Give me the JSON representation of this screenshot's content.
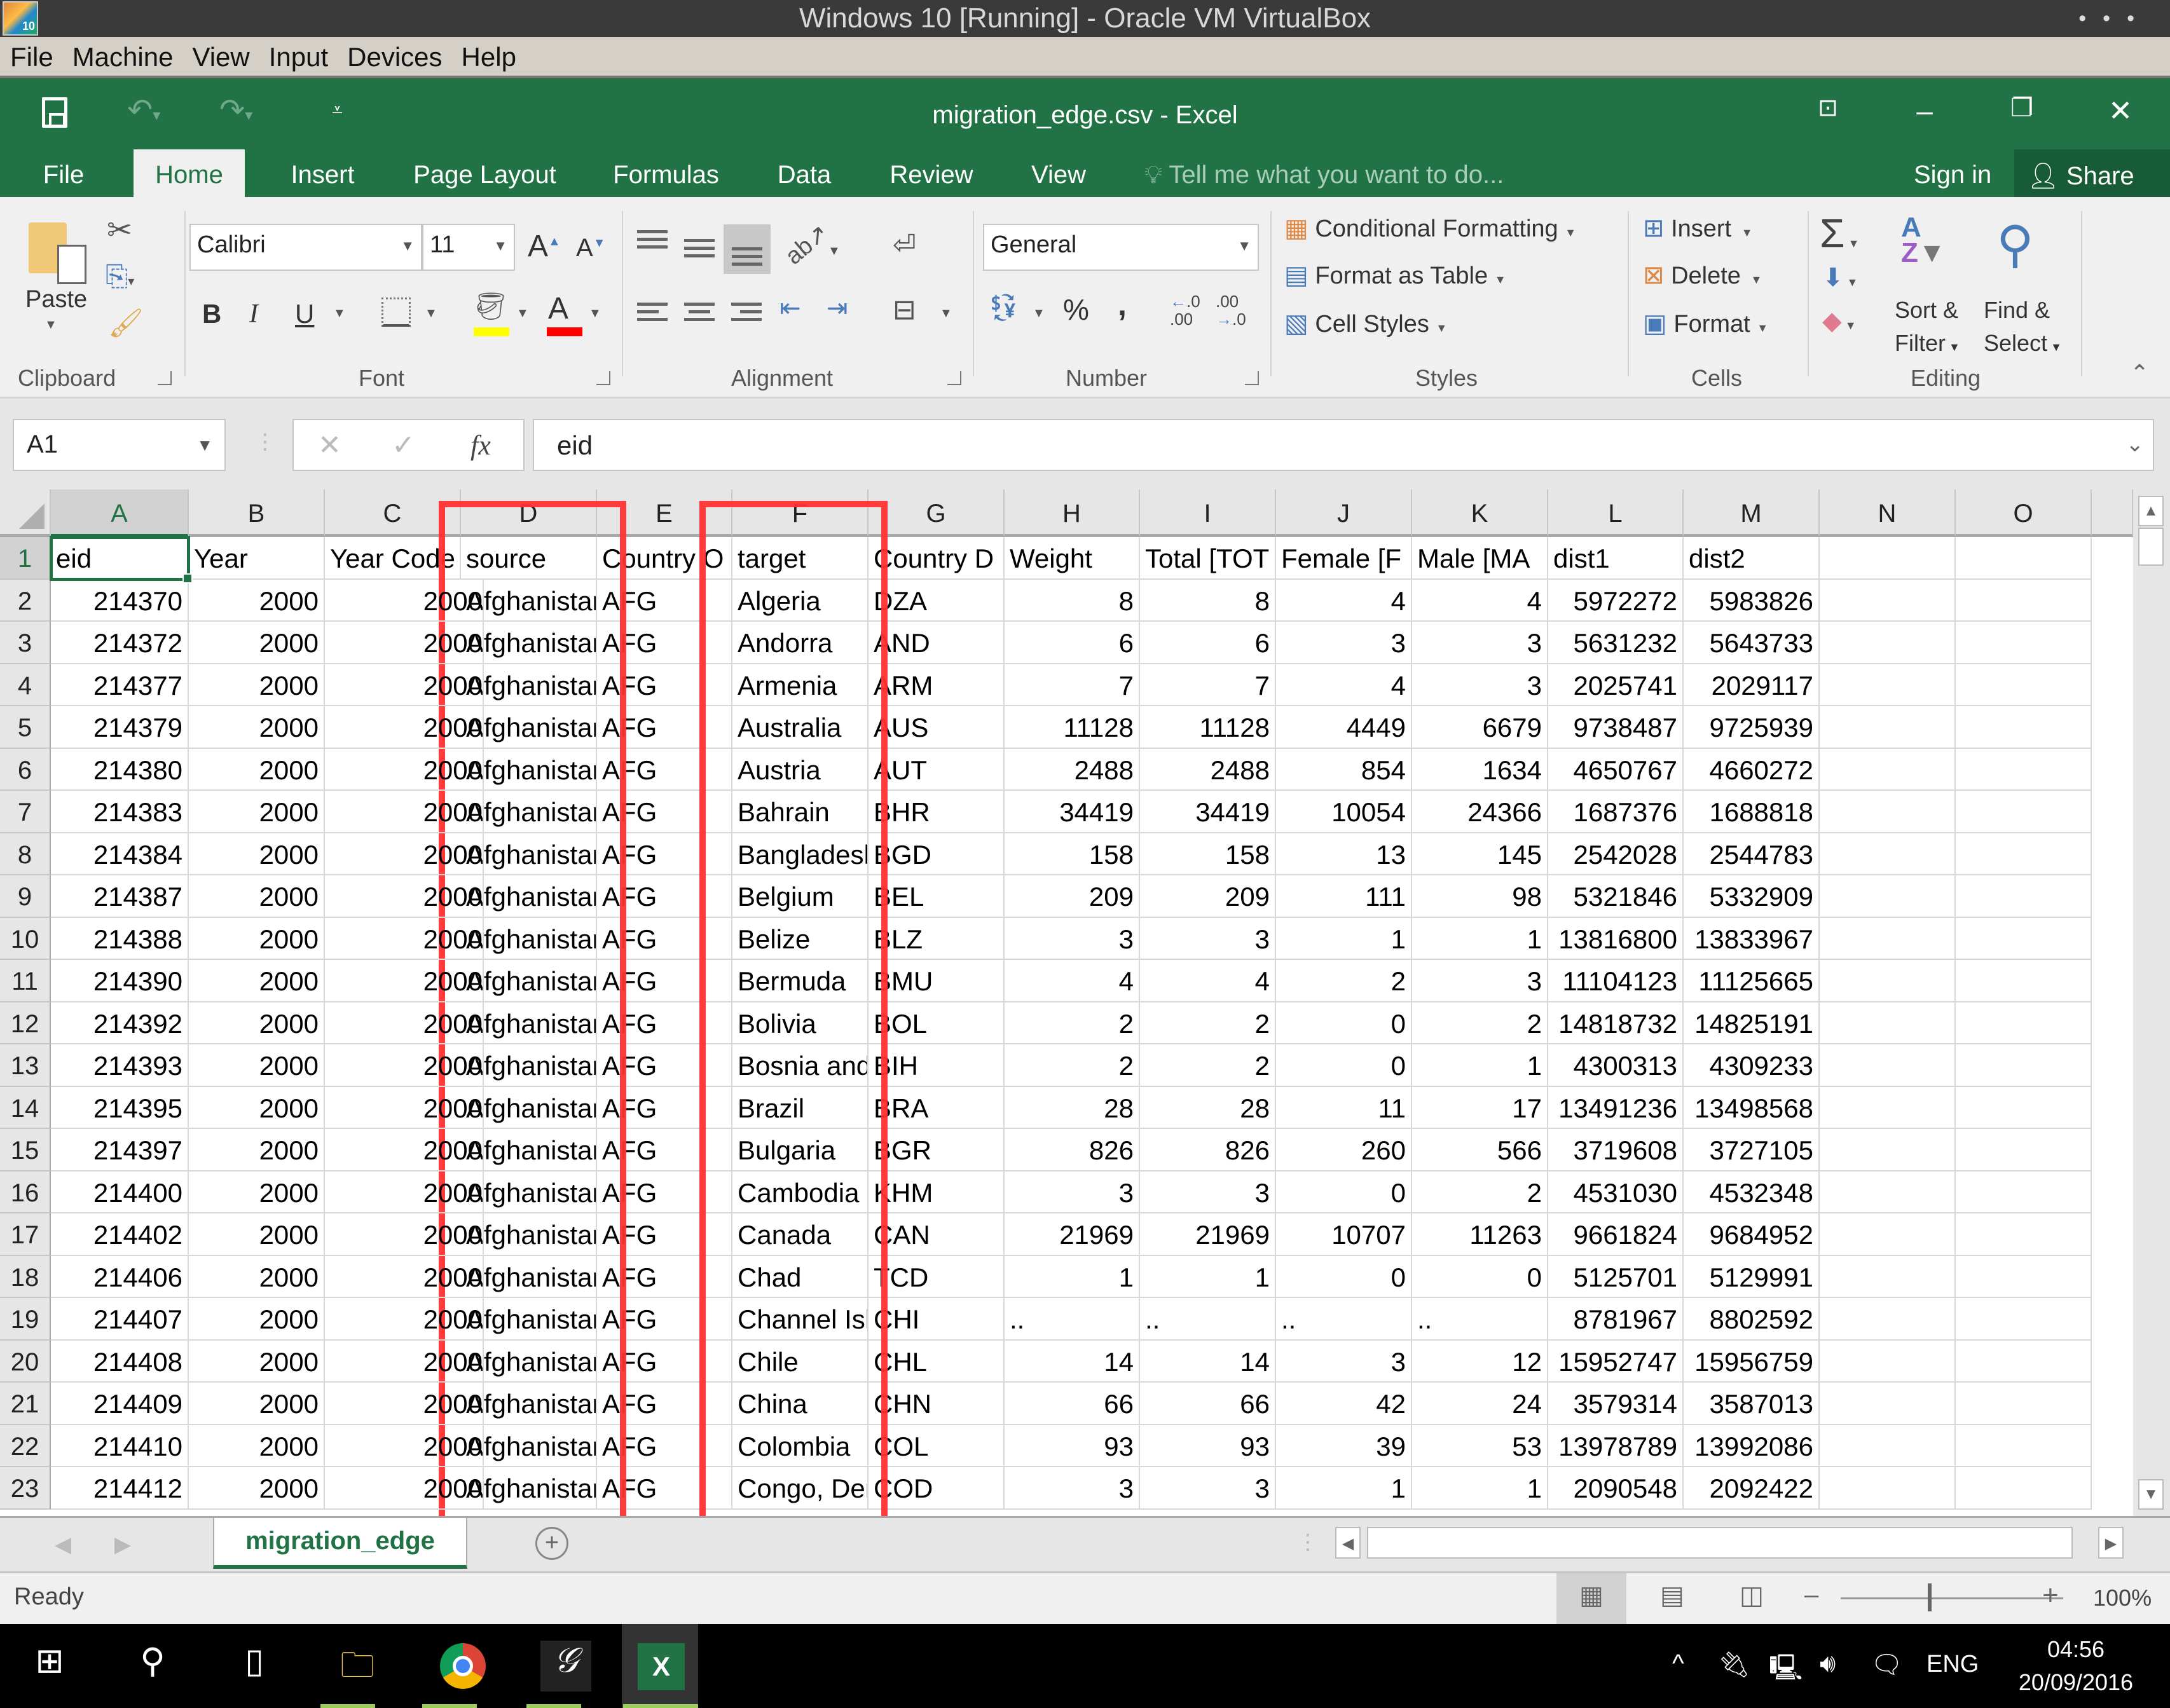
{
  "vbox": {
    "title": "Windows 10 [Running] - Oracle VM VirtualBox",
    "menu": [
      "File",
      "Machine",
      "View",
      "Input",
      "Devices",
      "Help"
    ]
  },
  "excel": {
    "doc_title": "migration_edge.csv - Excel",
    "tabs": [
      "File",
      "Home",
      "Insert",
      "Page Layout",
      "Formulas",
      "Data",
      "Review",
      "View"
    ],
    "active_tab": "Home",
    "tell_me": "Tell me what you want to do...",
    "sign_in": "Sign in",
    "share": "Share"
  },
  "ribbon": {
    "clipboard": {
      "label": "Clipboard",
      "paste": "Paste"
    },
    "font": {
      "label": "Font",
      "font_name": "Calibri",
      "font_size": "11",
      "bold": "B",
      "italic": "I",
      "underline": "U",
      "highlight_color": "#ffff00",
      "font_color": "#ff0000"
    },
    "alignment": {
      "label": "Alignment"
    },
    "number": {
      "label": "Number",
      "format": "General",
      "percent": "%",
      "comma": ","
    },
    "styles": {
      "label": "Styles",
      "conditional": "Conditional Formatting",
      "format_table": "Format as Table",
      "cell_styles": "Cell Styles"
    },
    "cells": {
      "label": "Cells",
      "insert": "Insert",
      "delete": "Delete",
      "format": "Format"
    },
    "editing": {
      "label": "Editing",
      "sort": "Sort &",
      "filter": "Filter",
      "find": "Find &",
      "select": "Select"
    }
  },
  "formula_bar": {
    "name_box": "A1",
    "content": "eid"
  },
  "sheet": {
    "columns": [
      "A",
      "B",
      "C",
      "D",
      "E",
      "F",
      "G",
      "H",
      "I",
      "J",
      "K",
      "L",
      "M",
      "N",
      "O"
    ],
    "headers": [
      "eid",
      "Year",
      "Year Code",
      "source",
      "Country Origin Code",
      "target",
      "Country Dest Code",
      "Weight",
      "Total [TOTAL]",
      "Female [FEMALE]",
      "Male [MALE]",
      "dist1",
      "dist2"
    ],
    "header_display": [
      "eid",
      "Year",
      "Year Code",
      "source",
      "Country O",
      "target",
      "Country D",
      "Weight",
      "Total [TOT",
      "Female [F",
      "Male [MA",
      "dist1",
      "dist2"
    ],
    "rows": [
      [
        "214370",
        "2000",
        "2000",
        "Afghanistan",
        "AFG",
        "Algeria",
        "DZA",
        "8",
        "8",
        "4",
        "4",
        "5972272",
        "5983826"
      ],
      [
        "214372",
        "2000",
        "2000",
        "Afghanistan",
        "AFG",
        "Andorra",
        "AND",
        "6",
        "6",
        "3",
        "3",
        "5631232",
        "5643733"
      ],
      [
        "214377",
        "2000",
        "2000",
        "Afghanistan",
        "AFG",
        "Armenia",
        "ARM",
        "7",
        "7",
        "4",
        "3",
        "2025741",
        "2029117"
      ],
      [
        "214379",
        "2000",
        "2000",
        "Afghanistan",
        "AFG",
        "Australia",
        "AUS",
        "11128",
        "11128",
        "4449",
        "6679",
        "9738487",
        "9725939"
      ],
      [
        "214380",
        "2000",
        "2000",
        "Afghanistan",
        "AFG",
        "Austria",
        "AUT",
        "2488",
        "2488",
        "854",
        "1634",
        "4650767",
        "4660272"
      ],
      [
        "214383",
        "2000",
        "2000",
        "Afghanistan",
        "AFG",
        "Bahrain",
        "BHR",
        "34419",
        "34419",
        "10054",
        "24366",
        "1687376",
        "1688818"
      ],
      [
        "214384",
        "2000",
        "2000",
        "Afghanistan",
        "AFG",
        "Bangladesh",
        "BGD",
        "158",
        "158",
        "13",
        "145",
        "2542028",
        "2544783"
      ],
      [
        "214387",
        "2000",
        "2000",
        "Afghanistan",
        "AFG",
        "Belgium",
        "BEL",
        "209",
        "209",
        "111",
        "98",
        "5321846",
        "5332909"
      ],
      [
        "214388",
        "2000",
        "2000",
        "Afghanistan",
        "AFG",
        "Belize",
        "BLZ",
        "3",
        "3",
        "1",
        "1",
        "13816800",
        "13833967"
      ],
      [
        "214390",
        "2000",
        "2000",
        "Afghanistan",
        "AFG",
        "Bermuda",
        "BMU",
        "4",
        "4",
        "2",
        "3",
        "11104123",
        "11125665"
      ],
      [
        "214392",
        "2000",
        "2000",
        "Afghanistan",
        "AFG",
        "Bolivia",
        "BOL",
        "2",
        "2",
        "0",
        "2",
        "14818732",
        "14825191"
      ],
      [
        "214393",
        "2000",
        "2000",
        "Afghanistan",
        "AFG",
        "Bosnia and",
        "BIH",
        "2",
        "2",
        "0",
        "1",
        "4300313",
        "4309233"
      ],
      [
        "214395",
        "2000",
        "2000",
        "Afghanistan",
        "AFG",
        "Brazil",
        "BRA",
        "28",
        "28",
        "11",
        "17",
        "13491236",
        "13498568"
      ],
      [
        "214397",
        "2000",
        "2000",
        "Afghanistan",
        "AFG",
        "Bulgaria",
        "BGR",
        "826",
        "826",
        "260",
        "566",
        "3719608",
        "3727105"
      ],
      [
        "214400",
        "2000",
        "2000",
        "Afghanistan",
        "AFG",
        "Cambodia",
        "KHM",
        "3",
        "3",
        "0",
        "2",
        "4531030",
        "4532348"
      ],
      [
        "214402",
        "2000",
        "2000",
        "Afghanistan",
        "AFG",
        "Canada",
        "CAN",
        "21969",
        "21969",
        "10707",
        "11263",
        "9661824",
        "9684952"
      ],
      [
        "214406",
        "2000",
        "2000",
        "Afghanistan",
        "AFG",
        "Chad",
        "TCD",
        "1",
        "1",
        "0",
        "0",
        "5125701",
        "5129991"
      ],
      [
        "214407",
        "2000",
        "2000",
        "Afghanistan",
        "AFG",
        "Channel Islands",
        "CHI",
        "..",
        "..",
        "..",
        "..",
        "8781967",
        "8802592"
      ],
      [
        "214408",
        "2000",
        "2000",
        "Afghanistan",
        "AFG",
        "Chile",
        "CHL",
        "14",
        "14",
        "3",
        "12",
        "15952747",
        "15956759"
      ],
      [
        "214409",
        "2000",
        "2000",
        "Afghanistan",
        "AFG",
        "China",
        "CHN",
        "66",
        "66",
        "42",
        "24",
        "3579314",
        "3587013"
      ],
      [
        "214410",
        "2000",
        "2000",
        "Afghanistan",
        "AFG",
        "Colombia",
        "COL",
        "93",
        "93",
        "39",
        "53",
        "13978789",
        "13992086"
      ],
      [
        "214412",
        "2000",
        "2000",
        "Afghanistan",
        "AFG",
        "Congo, Dem. Rep.",
        "COD",
        "3",
        "3",
        "1",
        "1",
        "2090548",
        "2092422"
      ]
    ],
    "highlighted_columns": [
      "D",
      "F"
    ],
    "highlight_color": "#ff3030",
    "sheet_tab": "migration_edge"
  },
  "status": {
    "text": "Ready",
    "zoom": "100%"
  },
  "taskbar": {
    "apps": [
      "windows-start",
      "search",
      "task-view",
      "file-explorer",
      "chrome",
      "other-app",
      "excel"
    ],
    "lang": "ENG",
    "time": "04:56",
    "date": "20/09/2016"
  },
  "colors": {
    "excel_green": "#217346",
    "dark_green": "#185c37"
  }
}
